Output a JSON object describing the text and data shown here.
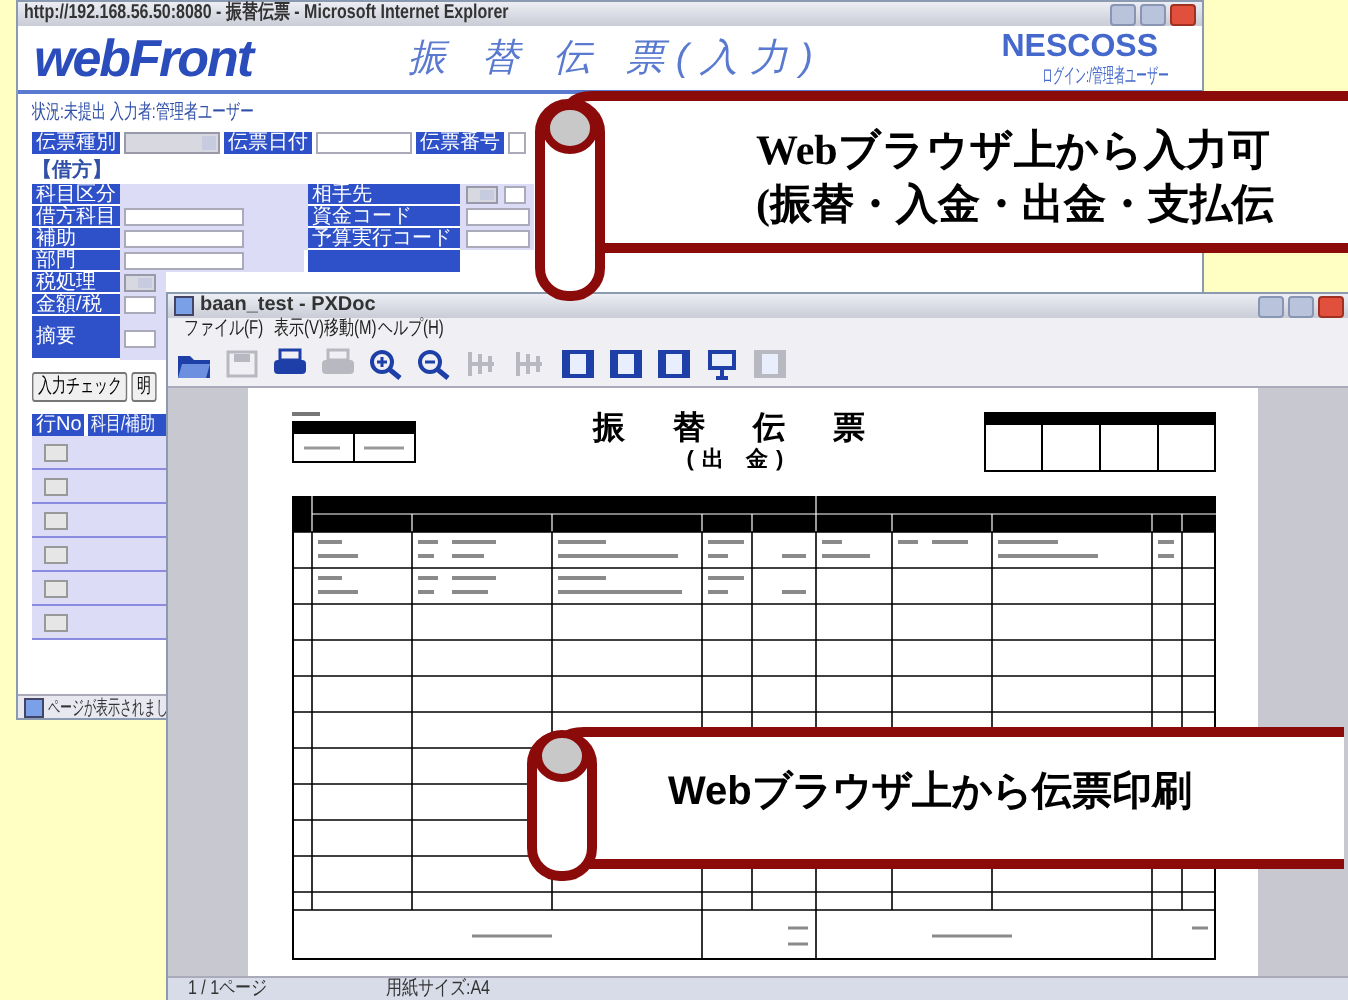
{
  "browser_window": {
    "title": "http://192.168.56.50:8080 - 振替伝票 - Microsoft Internet Explorer",
    "logo": "webFront",
    "page_title": "振 替 伝 票(入力)",
    "brand": "NESCOSS",
    "login": "ログイン:/管理者ユーザー",
    "status_line": "状況:未提出  入力者:管理者ユーザー",
    "header_fields": [
      {
        "label": "伝票種別",
        "kind": "select"
      },
      {
        "label": "伝票日付",
        "kind": "input"
      },
      {
        "label": "伝票番号",
        "kind": "input"
      }
    ],
    "section": "【借方】",
    "left_fields": [
      {
        "label": "科目区分",
        "kind": "blank"
      },
      {
        "label": "借方科目",
        "kind": "input"
      },
      {
        "label": "補助",
        "kind": "input"
      },
      {
        "label": "部門",
        "kind": "input"
      },
      {
        "label": "税処理",
        "kind": "two-select"
      },
      {
        "label": "金額/税",
        "kind": "input"
      },
      {
        "label": "摘要",
        "kind": "tall"
      }
    ],
    "right_fields": [
      {
        "label": "相手先",
        "kind": "select"
      },
      {
        "label": "資金コード",
        "kind": "input"
      },
      {
        "label": "予算実行コード",
        "kind": "input"
      }
    ],
    "buttons": [
      "入力チェック",
      "明"
    ],
    "lines_columns": [
      "行No",
      "科目/補助"
    ],
    "status": "ページが表示されまし"
  },
  "pxdoc_window": {
    "title": "baan_test - PXDoc",
    "menu": [
      "ファイル(F)",
      "表示(V)",
      "移動(M)",
      "ヘルプ(H)"
    ],
    "toolbar": [
      {
        "kind": "folder",
        "disabled": false
      },
      {
        "kind": "save",
        "disabled": true
      },
      {
        "kind": "printer",
        "disabled": false
      },
      {
        "kind": "printer",
        "disabled": true
      },
      {
        "kind": "zoom-in",
        "disabled": false
      },
      {
        "kind": "zoom-out",
        "disabled": false
      },
      {
        "kind": "nav",
        "disabled": true
      },
      {
        "kind": "nav",
        "disabled": true
      },
      {
        "kind": "page",
        "disabled": false
      },
      {
        "kind": "page",
        "disabled": false
      },
      {
        "kind": "page",
        "disabled": false
      },
      {
        "kind": "monitor",
        "disabled": false
      },
      {
        "kind": "page",
        "disabled": true
      }
    ],
    "document": {
      "title": "振 替 伝 票",
      "subtitle": "(出 金)"
    },
    "status": [
      "1 / 1ページ",
      "用紙サイズ:A4"
    ]
  },
  "callouts": [
    {
      "kind": "serif",
      "lines": [
        "Webブラウザ上から入力可",
        "(振替・入金・出金・支払伝"
      ]
    },
    {
      "kind": "sans",
      "lines": [
        "Webブラウザ上から伝票印刷"
      ]
    }
  ]
}
